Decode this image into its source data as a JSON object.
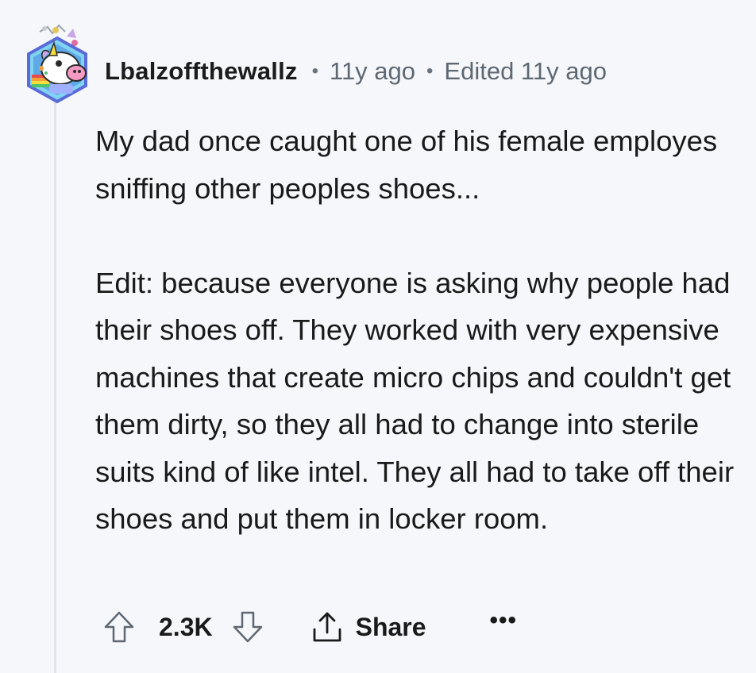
{
  "comment": {
    "author": "Lbalzoffthewallz",
    "posted": "11y ago",
    "edited": "Edited 11y ago",
    "separator": "•",
    "paragraphs": [
      "My dad once caught one of his female employes sniffing other peoples shoes...",
      "Edit: because everyone is asking why people had their shoes off. They worked with very expensive machines that create micro chips and couldn't get them dirty, so they all had to change into sterile suits kind of like intel. They all had to take off their shoes and put them in locker room."
    ]
  },
  "actions": {
    "score": "2.3K",
    "share_label": "Share",
    "more_label": "•••"
  },
  "icons": {
    "upvote": "arrow-up-outline-icon",
    "downvote": "arrow-down-outline-icon",
    "share": "share-upload-icon",
    "more": "ellipsis-icon",
    "avatar": "unicorn-snoo-avatar"
  },
  "colors": {
    "background": "#f6f7fa",
    "text": "#1a1a1b",
    "meta": "#5e6872",
    "thread_line": "#dfe3ea"
  }
}
